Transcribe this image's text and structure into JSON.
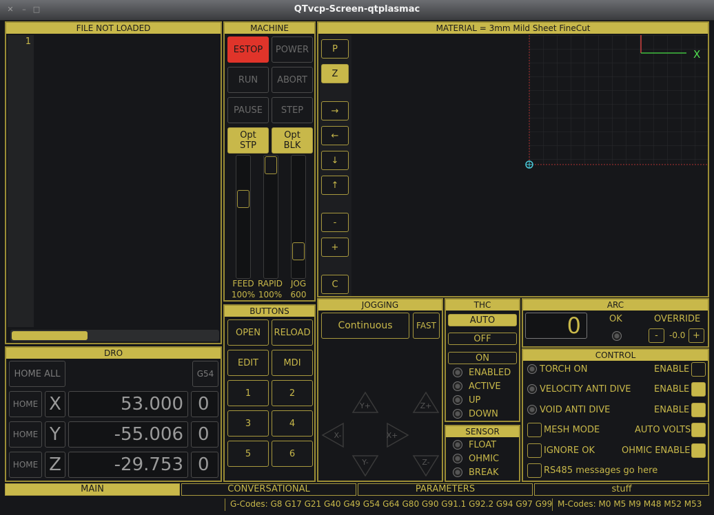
{
  "window": {
    "title": "QTvcp-Screen-qtplasmac"
  },
  "file_panel": {
    "header": "FILE NOT LOADED",
    "line_number": "1"
  },
  "machine": {
    "header": "MACHINE",
    "estop": "ESTOP",
    "power": "POWER",
    "run": "RUN",
    "abort": "ABORT",
    "pause": "PAUSE",
    "step": "STEP",
    "opt_stp": "Opt\nSTP",
    "opt_blk": "Opt\nBLK",
    "feed_label": "FEED",
    "feed_value": "100%",
    "rapid_label": "RAPID",
    "rapid_value": "100%",
    "jog_label": "JOG",
    "jog_value": "600"
  },
  "material": {
    "header": "MATERIAL = 3mm Mild Sheet FineCut",
    "axis_x_label": "X"
  },
  "view_buttons": [
    "P",
    "Z",
    "→",
    "←",
    "↓",
    "↑",
    "-",
    "+",
    "C"
  ],
  "buttons_panel": {
    "header": "BUTTONS",
    "open": "OPEN",
    "reload": "RELOAD",
    "edit": "EDIT",
    "mdi": "MDI",
    "b1": "1",
    "b2": "2",
    "b3": "3",
    "b4": "4",
    "b5": "5",
    "b6": "6"
  },
  "dro": {
    "header": "DRO",
    "home_all": "HOME ALL",
    "offset": "G54",
    "axes": [
      {
        "home": "HOME",
        "axis": "X",
        "value": "53.000",
        "digit": "0"
      },
      {
        "home": "HOME",
        "axis": "Y",
        "value": "-55.006",
        "digit": "0"
      },
      {
        "home": "HOME",
        "axis": "Z",
        "value": "-29.753",
        "digit": "0"
      }
    ]
  },
  "jogging": {
    "header": "JOGGING",
    "mode": "Continuous",
    "fast": "FAST",
    "y_plus": "Y+",
    "z_plus": "Z+",
    "x_minus": "X-",
    "x_plus": "X+",
    "y_minus": "Y-",
    "z_minus": "Z-"
  },
  "thc": {
    "header": "THC",
    "auto": "AUTO",
    "off": "OFF",
    "on": "ON",
    "enabled": "ENABLED",
    "active": "ACTIVE",
    "up": "UP",
    "down": "DOWN"
  },
  "sensor": {
    "header": "SENSOR",
    "float": "FLOAT",
    "ohmic": "OHMIC",
    "break": "BREAK"
  },
  "arc": {
    "header": "ARC",
    "value": "0",
    "ok": "OK",
    "override": "OVERRIDE",
    "minus": "-",
    "override_value": "-0.0",
    "plus": "+"
  },
  "control": {
    "header": "CONTROL",
    "torch_on": "TORCH ON",
    "velocity_anti_dive": "VELOCITY ANTI DIVE",
    "void_anti_dive": "VOID ANTI DIVE",
    "enable": "ENABLE",
    "mesh_mode": "MESH MODE",
    "auto_volts": "AUTO VOLTS",
    "ignore_ok": "IGNORE OK",
    "ohmic_enable": "OHMIC ENABLE",
    "rs485": "RS485 messages go here"
  },
  "tabs": [
    "MAIN",
    "CONVERSATIONAL",
    "PARAMETERS",
    "stuff"
  ],
  "status": {
    "gcodes": "G-Codes: G8 G17 G21 G40 G49 G54 G64 G80 G90 G91.1 G92.2 G94 G97 G99",
    "mcodes": "M-Codes: M0 M5 M9 M48 M52 M53"
  },
  "colors": {
    "accent": "#c8b84a",
    "estop": "#e0342a",
    "background": "#16171a"
  }
}
